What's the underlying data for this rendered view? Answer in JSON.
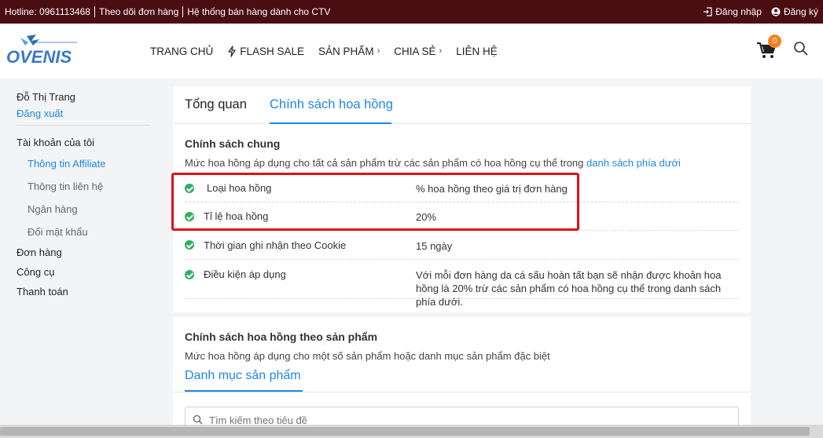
{
  "topbar": {
    "hotline": "Hotline: 0961113468",
    "track_order": "Theo dõi đơn hàng",
    "ctv_system": "Hệ thống bán hàng dành cho CTV",
    "login": "Đăng nhập",
    "register": "Đăng ký"
  },
  "header": {
    "logo_text": "OVENIS",
    "nav": [
      {
        "label": "TRANG CHỦ"
      },
      {
        "label": "FLASH SALE"
      },
      {
        "label": "SẢN PHẨM"
      },
      {
        "label": "CHIA SẺ"
      },
      {
        "label": "LIÊN HỆ"
      }
    ],
    "cart_count": "0"
  },
  "sidebar": {
    "user_name": "Đỗ Thị Trang",
    "logout": "Đăng xuất",
    "my_account": "Tài khoản của tôi",
    "affiliate_info": "Thông tin Affiliate",
    "contact_info": "Thông tin liên hệ",
    "bank": "Ngân hàng",
    "change_password": "Đổi mật khẩu",
    "orders": "Đơn hàng",
    "tools": "Công cụ",
    "payment": "Thanh toán"
  },
  "main": {
    "tabs": [
      {
        "label": "Tổng quan"
      },
      {
        "label": "Chính sách hoa hồng"
      }
    ],
    "general_policy": {
      "title": "Chính sách chung",
      "desc": "Mức hoa hồng áp dụng cho tất cả sản phẩm trừ các sản phẩm có hoa hồng cụ thể trong",
      "desc_link": "danh sách phía dưới",
      "rows": [
        {
          "label": "Loại hoa hồng",
          "value": "% hoa hồng theo giá trị đơn hàng"
        },
        {
          "label": "Tỉ lệ hoa hồng",
          "value": "20%"
        },
        {
          "label": "Thời gian ghi nhận theo Cookie",
          "value": "15 ngày"
        },
        {
          "label": "Điều kiện áp dụng",
          "value": "Với mỗi đơn hàng da cá sấu hoàn tất bạn sẽ nhận được khoản hoa hồng là 20% trừ các sản phẩm có hoa hồng cụ thể trong danh sách phía dưới."
        }
      ]
    },
    "product_policy": {
      "title": "Chính sách hoa hồng theo sản phẩm",
      "desc": "Mức hoa hồng áp dụng cho một số sản phẩm hoặc danh mục sản phẩm đặc biệt",
      "tab": "Danh mục sản phẩm",
      "search_placeholder": "Tìm kiếm theo tiêu đề"
    }
  },
  "colors": {
    "topbar_bg": "#4a0d12",
    "accent": "#1e88e5",
    "check": "#2eb05e",
    "highlight": "#e0101a",
    "badge": "#f5821f"
  }
}
